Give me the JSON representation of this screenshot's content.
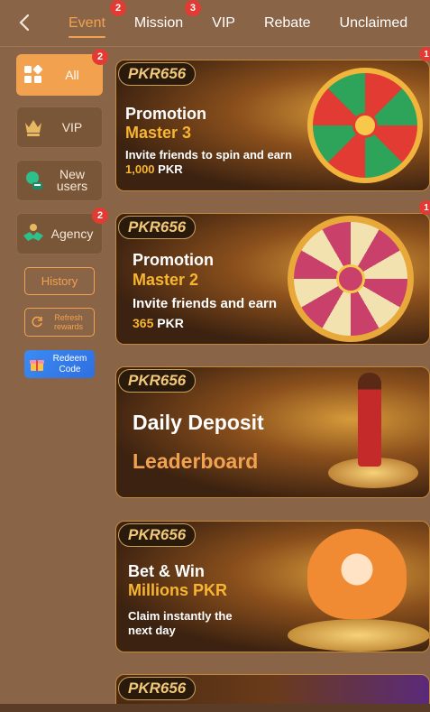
{
  "nav": {
    "back_icon": "chevron-left-icon",
    "tabs": [
      {
        "label": "Event",
        "badge": "2",
        "active": true
      },
      {
        "label": "Mission",
        "badge": "3",
        "active": false
      },
      {
        "label": "VIP",
        "badge": "",
        "active": false
      },
      {
        "label": "Rebate",
        "badge": "",
        "active": false
      },
      {
        "label": "Unclaimed",
        "badge": "",
        "active": false
      }
    ]
  },
  "sidebar": {
    "categories": [
      {
        "label": "All",
        "icon": "grid-icon",
        "badge": "2",
        "active": true
      },
      {
        "label": "VIP",
        "icon": "crown-icon",
        "badge": "",
        "active": false
      },
      {
        "label": "New users",
        "icon": "user-icon",
        "badge": "",
        "active": false
      },
      {
        "label": "Agency",
        "icon": "handshake-icon",
        "badge": "2",
        "active": false
      }
    ],
    "history": "History",
    "refresh": "Refresh rewards",
    "redeem": "Redeem Code"
  },
  "banners": [
    {
      "brand": "PKR656",
      "line1": "Promotion",
      "line2": "Master 3",
      "line3": "Invite friends to spin and earn",
      "amount": "1,000",
      "currency": "PKR",
      "badge": "1"
    },
    {
      "brand": "PKR656",
      "line1": "Promotion",
      "line2": "Master 2",
      "line3": "Invite friends and earn",
      "amount": "365",
      "currency": "PKR",
      "badge": "1"
    },
    {
      "brand": "PKR656",
      "line1": "Daily Deposit",
      "line2": "Leaderboard"
    },
    {
      "brand": "PKR656",
      "line1": "Bet & Win",
      "line2": "Millions PKR",
      "line3": "Claim instantly the",
      "line4": "next day"
    },
    {
      "brand": "PKR656"
    }
  ],
  "colors": {
    "accent": "#f2a24f",
    "badge": "#e23b34",
    "background": "#8a6447"
  }
}
